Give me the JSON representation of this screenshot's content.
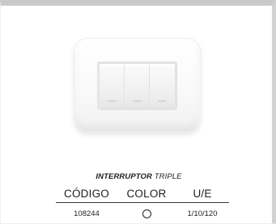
{
  "product": {
    "title_bold": "INTERRUPTOR",
    "title_rest": "TRIPLE",
    "image_name": "triple-switch-white"
  },
  "table": {
    "headers": [
      "CÓDIGO",
      "COLOR",
      "U/E"
    ],
    "rows": [
      {
        "code": "108244",
        "color_name": "white",
        "color_hex": "#ffffff",
        "ue": "1/10/120"
      }
    ]
  }
}
